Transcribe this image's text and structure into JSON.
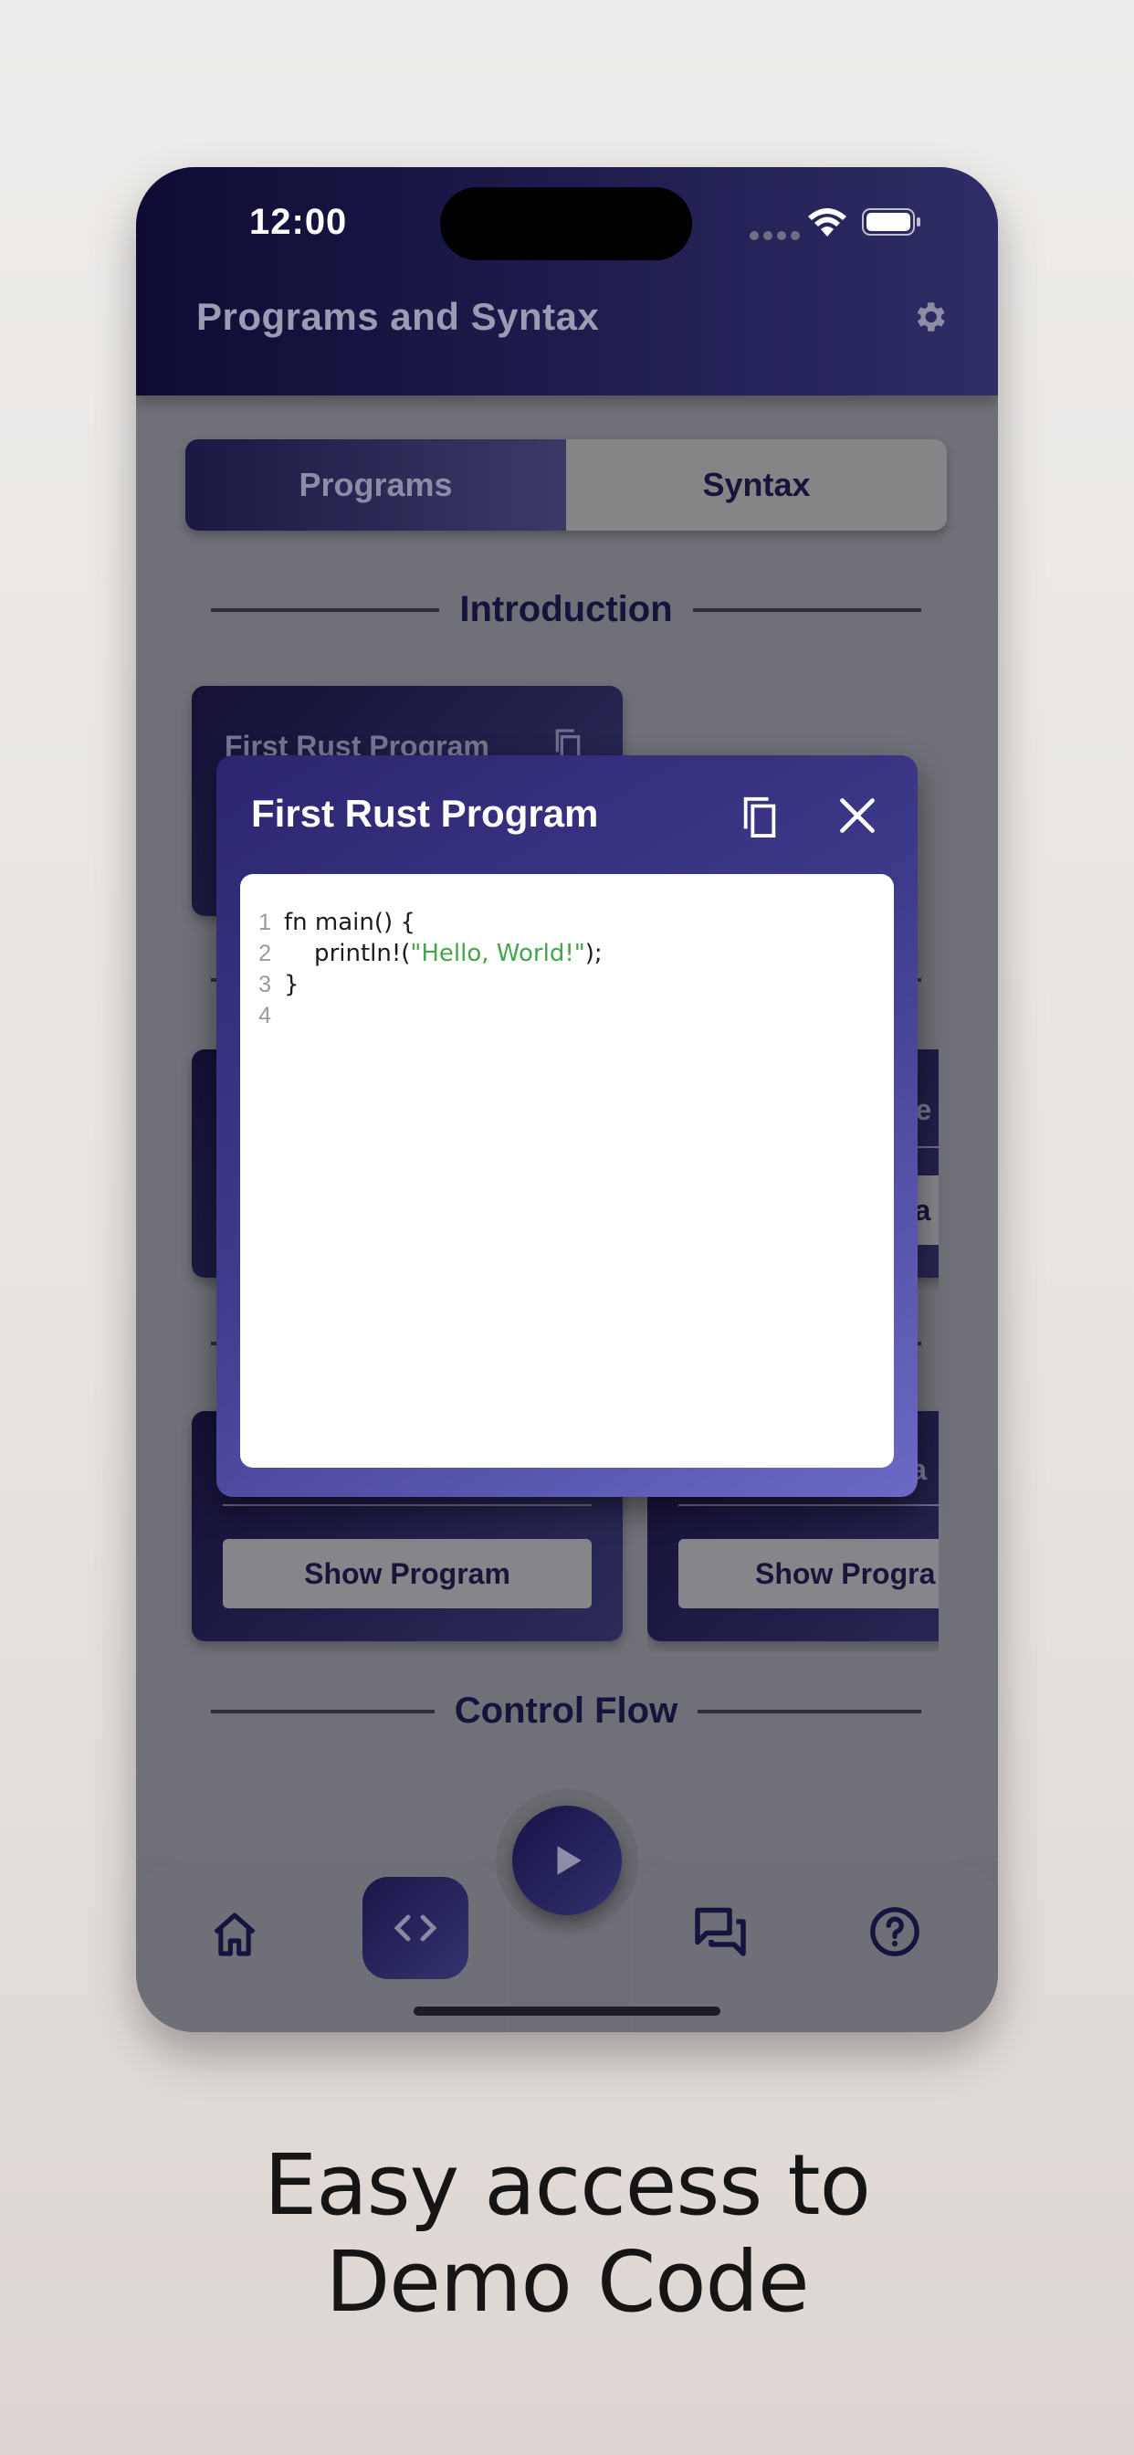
{
  "status_bar": {
    "time": "12:00"
  },
  "app_bar": {
    "title": "Programs and Syntax",
    "settings_icon": "gear-icon"
  },
  "segmented": {
    "programs": "Programs",
    "syntax": "Syntax"
  },
  "sections": {
    "introduction": "Introduction",
    "control_flow": "Control Flow"
  },
  "cards": {
    "first": {
      "title": "First Rust Program"
    },
    "partial_right_1": {
      "title_fragment": "pe",
      "button_fragment": "ra"
    },
    "partial_right_2": {
      "title_fragment": "era"
    },
    "bottom_left": {
      "button": "Show Program"
    },
    "bottom_right": {
      "button": "Show Progra"
    }
  },
  "dialog": {
    "title": "First Rust Program",
    "code_lines": [
      {
        "n": "1",
        "text": "fn main() {"
      },
      {
        "n": "2",
        "pre": "    println!(",
        "str": "\"Hello, World!\"",
        "post": ");"
      },
      {
        "n": "3",
        "text": "}"
      },
      {
        "n": "4",
        "text": ""
      }
    ]
  },
  "bottom_nav": {
    "items": [
      "home-icon",
      "code-icon",
      "play-icon",
      "chat-icon",
      "help-icon"
    ]
  },
  "caption": {
    "line1": "Easy access to",
    "line2": "Demo Code"
  },
  "colors": {
    "header_start": "#0e0b33",
    "header_end": "#2e2d66",
    "dialog_start": "#2c2670",
    "dialog_end": "#6c69c6",
    "code_string": "#45a54a"
  }
}
